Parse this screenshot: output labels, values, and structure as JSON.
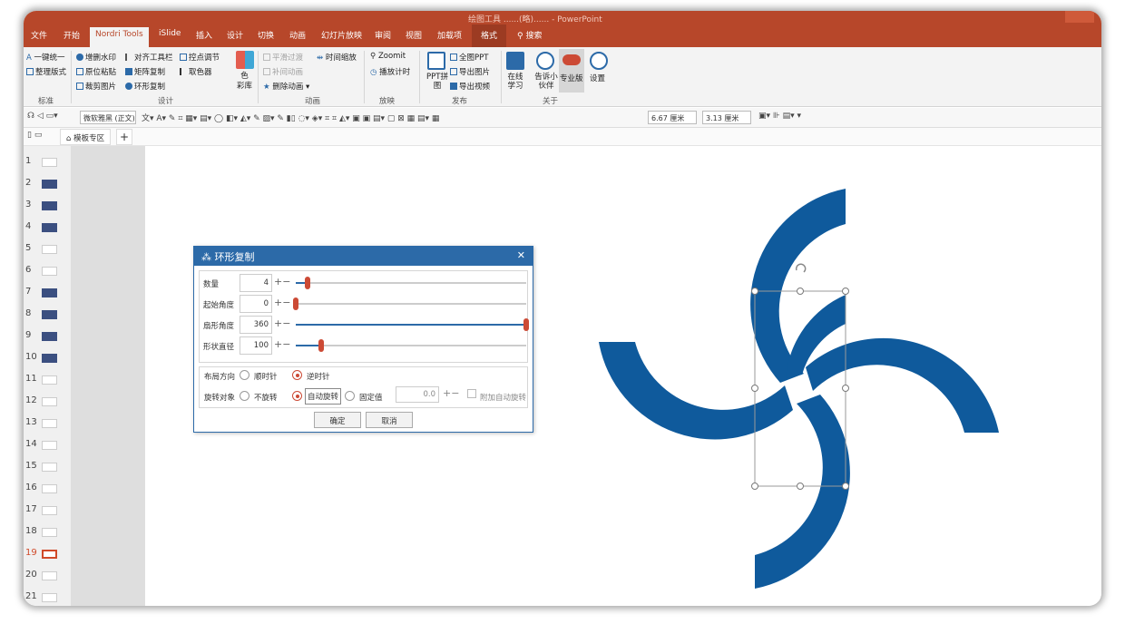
{
  "titlebar": {
    "text": "绘图工具 ......(略)...... - PowerPoint"
  },
  "tabs": [
    "文件",
    "开始",
    "Nordri Tools",
    "iSlide",
    "插入",
    "设计",
    "切换",
    "动画",
    "幻灯片放映",
    "审阅",
    "视图",
    "加载项",
    "格式"
  ],
  "search": "搜索",
  "ribbon": {
    "std": {
      "items": [
        "一键统一",
        "整理版式"
      ],
      "label": "标准"
    },
    "design": {
      "items": [
        "增删水印",
        "原位粘贴",
        "裁剪图片",
        "对齐工具栏",
        "矩阵复制",
        "环形复制",
        "控点调节",
        "取色器"
      ],
      "color_lib": "色\n彩库",
      "label": "设计"
    },
    "anim": {
      "items": [
        "平滑过渡",
        "补间动画",
        "删除动画",
        "时间缩放"
      ],
      "label": "动画"
    },
    "play": {
      "items": [
        "Zoomit",
        "播放计时"
      ],
      "label": "放映"
    },
    "publish": {
      "items": [
        "PPT拼图",
        "全图PPT",
        "导出图片",
        "导出视频"
      ],
      "label": "发布"
    },
    "about": {
      "items": [
        "在线学习",
        "告诉小伙伴",
        "专业版",
        "设置"
      ],
      "label": "关于"
    }
  },
  "toolbar": {
    "font": "微软雅黑 (正文)",
    "width": "6.67 厘米",
    "height": "3.13 厘米"
  },
  "sheet_tab": "模板专区",
  "slides": [
    "1",
    "2",
    "3",
    "4",
    "5",
    "6",
    "7",
    "8",
    "9",
    "10",
    "11",
    "12",
    "13",
    "14",
    "15",
    "16",
    "17",
    "18",
    "19",
    "20",
    "21"
  ],
  "dialog": {
    "title": "环形复制",
    "rows": [
      {
        "label": "数量",
        "value": "4",
        "pct": 0.05
      },
      {
        "label": "起始角度",
        "value": "0",
        "pct": 0.0
      },
      {
        "label": "扇形角度",
        "value": "360",
        "pct": 1.0
      },
      {
        "label": "形状直径",
        "value": "100",
        "pct": 0.11
      }
    ],
    "layout_label": "布局方向",
    "cw": "顺时针",
    "ccw": "逆时针",
    "rot_label": "旋转对象",
    "no_rot": "不旋转",
    "auto_rot": "自动旋转",
    "fixed": "固定值",
    "fixed_val": "0.0",
    "extra": "附加自动旋转",
    "ok": "确定",
    "cancel": "取消"
  },
  "colors": {
    "brand": "#b7472a",
    "shape": "#0f5a9c",
    "accent": "#2c6aa8"
  }
}
